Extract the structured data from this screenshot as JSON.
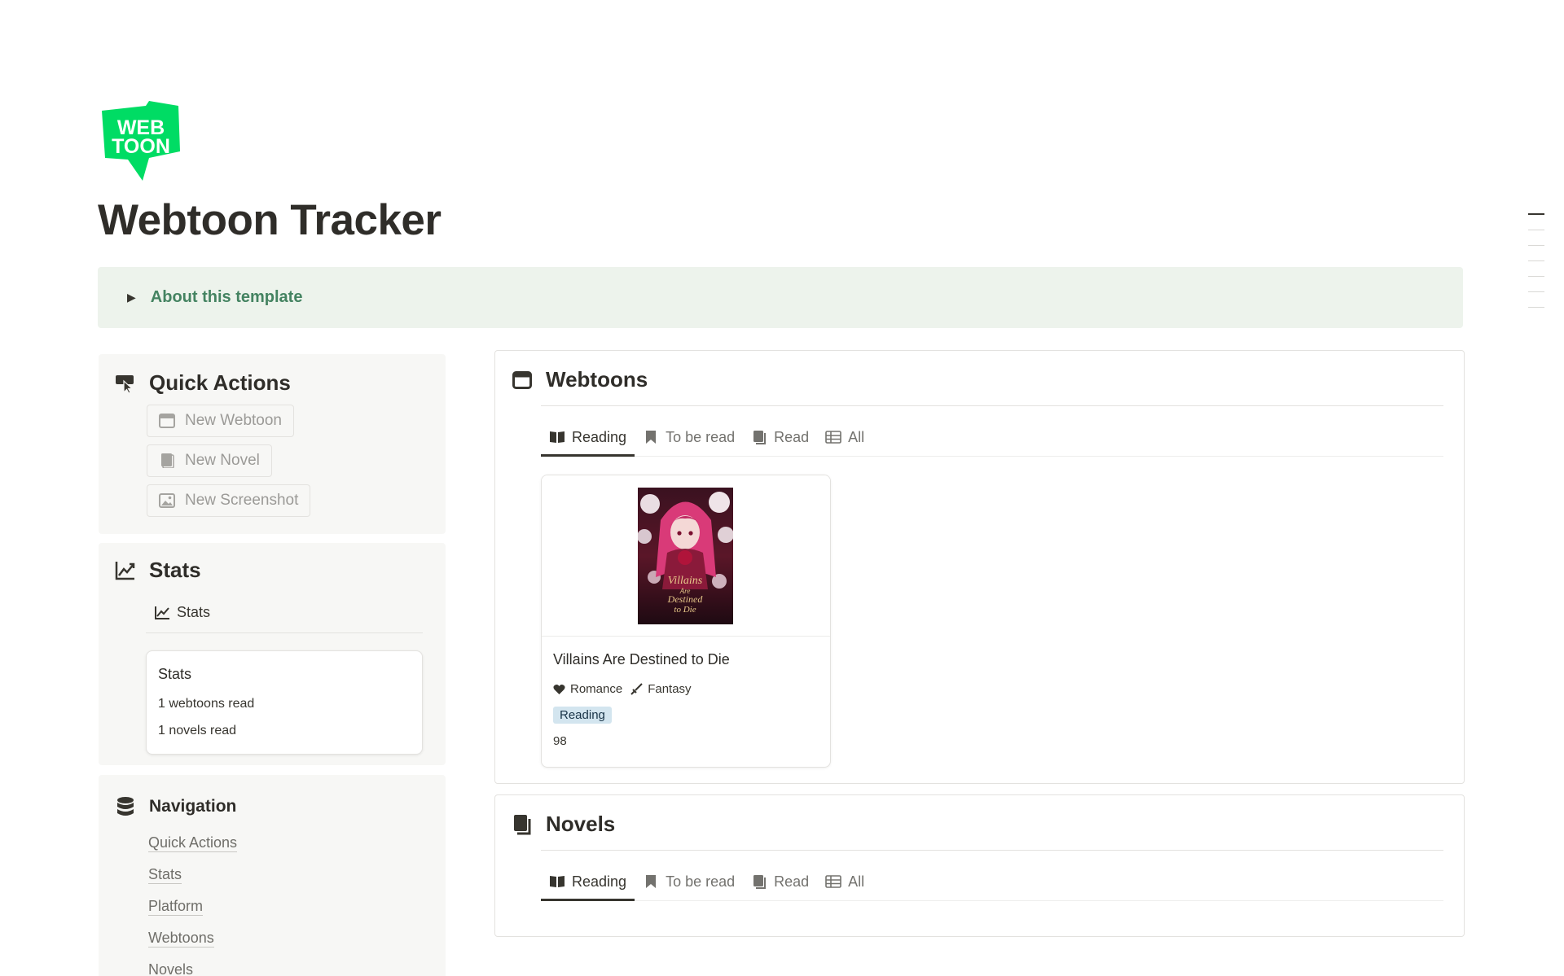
{
  "page": {
    "title": "Webtoon Tracker"
  },
  "logo": {
    "line1": "WEB",
    "line2": "TOON",
    "color": "#00dc64"
  },
  "callout": {
    "label": "About this template",
    "toggle_icon": "triangle-right-icon",
    "background": "#edf3ec",
    "text_color": "#448361"
  },
  "quick_actions": {
    "title": "Quick Actions",
    "icon": "cursor-click-icon",
    "buttons": [
      {
        "label": "New Webtoon",
        "icon": "window-icon"
      },
      {
        "label": "New Novel",
        "icon": "book-icon"
      },
      {
        "label": "New Screenshot",
        "icon": "image-icon"
      }
    ]
  },
  "stats": {
    "title": "Stats",
    "icon": "chart-line-icon",
    "tab_label": "Stats",
    "card": {
      "title": "Stats",
      "lines": [
        "1 webtoons read",
        "1 novels read"
      ]
    }
  },
  "navigation": {
    "title": "Navigation",
    "icon": "database-icon",
    "links": [
      "Quick Actions",
      "Stats",
      "Platform",
      "Webtoons",
      "Novels"
    ]
  },
  "webtoons": {
    "title": "Webtoons",
    "icon": "window-icon",
    "tabs": [
      {
        "label": "Reading",
        "icon": "open-book-icon",
        "active": true
      },
      {
        "label": "To be read",
        "icon": "bookmark-icon",
        "active": false
      },
      {
        "label": "Read",
        "icon": "book-icon",
        "active": false
      },
      {
        "label": "All",
        "icon": "table-icon",
        "active": false
      }
    ],
    "cards": [
      {
        "title": "Villains Are Destined to Die",
        "genres": [
          {
            "label": "Romance",
            "icon": "heart-icon"
          },
          {
            "label": "Fantasy",
            "icon": "sword-icon"
          }
        ],
        "status": "Reading",
        "status_color": "#d3e5ef",
        "number": "98",
        "cover_text": [
          "Villains",
          "Are",
          "Destined",
          "to Die"
        ]
      }
    ]
  },
  "novels": {
    "title": "Novels",
    "icon": "book-icon",
    "tabs": [
      {
        "label": "Reading",
        "icon": "open-book-icon",
        "active": true
      },
      {
        "label": "To be read",
        "icon": "bookmark-icon",
        "active": false
      },
      {
        "label": "Read",
        "icon": "book-icon",
        "active": false
      },
      {
        "label": "All",
        "icon": "table-icon",
        "active": false
      }
    ]
  }
}
